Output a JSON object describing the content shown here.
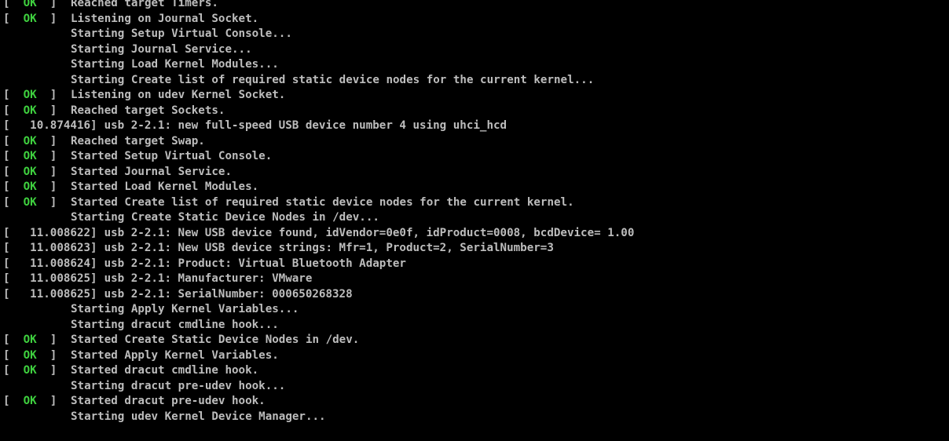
{
  "console": {
    "lines": [
      {
        "kind": "ok",
        "status": "OK",
        "text": "Reached target Timers."
      },
      {
        "kind": "ok",
        "status": "OK",
        "text": "Listening on Journal Socket."
      },
      {
        "kind": "plain",
        "text": "Starting Setup Virtual Console..."
      },
      {
        "kind": "plain",
        "text": "Starting Journal Service..."
      },
      {
        "kind": "plain",
        "text": "Starting Load Kernel Modules..."
      },
      {
        "kind": "plain",
        "text": "Starting Create list of required static device nodes for the current kernel..."
      },
      {
        "kind": "ok",
        "status": "OK",
        "text": "Listening on udev Kernel Socket."
      },
      {
        "kind": "ok",
        "status": "OK",
        "text": "Reached target Sockets."
      },
      {
        "kind": "kernel",
        "time": "10.874416",
        "text": "usb 2-2.1: new full-speed USB device number 4 using uhci_hcd"
      },
      {
        "kind": "ok",
        "status": "OK",
        "text": "Reached target Swap."
      },
      {
        "kind": "ok",
        "status": "OK",
        "text": "Started Setup Virtual Console."
      },
      {
        "kind": "ok",
        "status": "OK",
        "text": "Started Journal Service."
      },
      {
        "kind": "ok",
        "status": "OK",
        "text": "Started Load Kernel Modules."
      },
      {
        "kind": "ok",
        "status": "OK",
        "text": "Started Create list of required static device nodes for the current kernel."
      },
      {
        "kind": "plain",
        "text": "Starting Create Static Device Nodes in /dev..."
      },
      {
        "kind": "kernel",
        "time": "11.008622",
        "text": "usb 2-2.1: New USB device found, idVendor=0e0f, idProduct=0008, bcdDevice= 1.00"
      },
      {
        "kind": "kernel",
        "time": "11.008623",
        "text": "usb 2-2.1: New USB device strings: Mfr=1, Product=2, SerialNumber=3"
      },
      {
        "kind": "kernel",
        "time": "11.008624",
        "text": "usb 2-2.1: Product: Virtual Bluetooth Adapter"
      },
      {
        "kind": "kernel",
        "time": "11.008625",
        "text": "usb 2-2.1: Manufacturer: VMware"
      },
      {
        "kind": "kernel",
        "time": "11.008625",
        "text": "usb 2-2.1: SerialNumber: 000650268328"
      },
      {
        "kind": "plain",
        "text": "Starting Apply Kernel Variables..."
      },
      {
        "kind": "plain",
        "text": "Starting dracut cmdline hook..."
      },
      {
        "kind": "ok",
        "status": "OK",
        "text": "Started Create Static Device Nodes in /dev."
      },
      {
        "kind": "ok",
        "status": "OK",
        "text": "Started Apply Kernel Variables."
      },
      {
        "kind": "ok",
        "status": "OK",
        "text": "Started dracut cmdline hook."
      },
      {
        "kind": "plain",
        "text": "Starting dracut pre-udev hook..."
      },
      {
        "kind": "ok",
        "status": "OK",
        "text": "Started dracut pre-udev hook."
      },
      {
        "kind": "plain",
        "text": "Starting udev Kernel Device Manager..."
      }
    ]
  },
  "colors": {
    "background": "#000000",
    "text": "#bdbdbd",
    "ok_status": "#3fd13f"
  }
}
